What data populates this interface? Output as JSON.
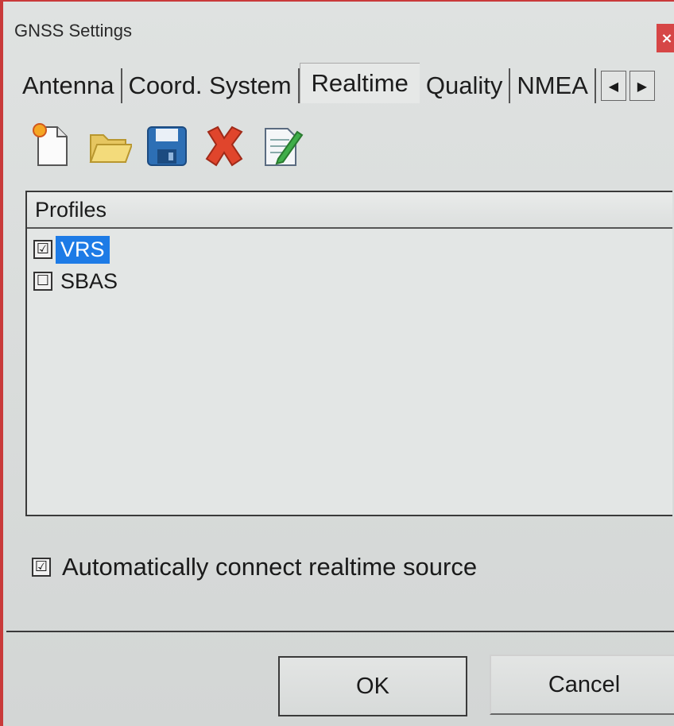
{
  "window": {
    "title": "GNSS Settings",
    "close_glyph": "×"
  },
  "tabs": {
    "items": [
      {
        "label": "Antenna"
      },
      {
        "label": "Coord. System"
      },
      {
        "label": "Realtime",
        "active": true
      },
      {
        "label": "Quality"
      },
      {
        "label": "NMEA"
      }
    ],
    "scroll_left": "◀",
    "scroll_right": "▶"
  },
  "toolbar": {
    "icons": [
      "new-file-icon",
      "open-folder-icon",
      "save-disk-icon",
      "delete-x-icon",
      "edit-document-icon"
    ]
  },
  "profiles": {
    "header": "Profiles",
    "items": [
      {
        "label": "VRS",
        "checked": true,
        "selected": true,
        "check_glyph": "☑"
      },
      {
        "label": "SBAS",
        "checked": false,
        "selected": false,
        "check_glyph": "☐"
      }
    ]
  },
  "auto_connect": {
    "label": "Automatically connect realtime source",
    "checked": true,
    "check_glyph": "☑"
  },
  "buttons": {
    "ok": "OK",
    "cancel": "Cancel"
  },
  "colors": {
    "selection": "#1d7be6",
    "close_button": "#d64646",
    "window_border": "#c93a3a"
  }
}
